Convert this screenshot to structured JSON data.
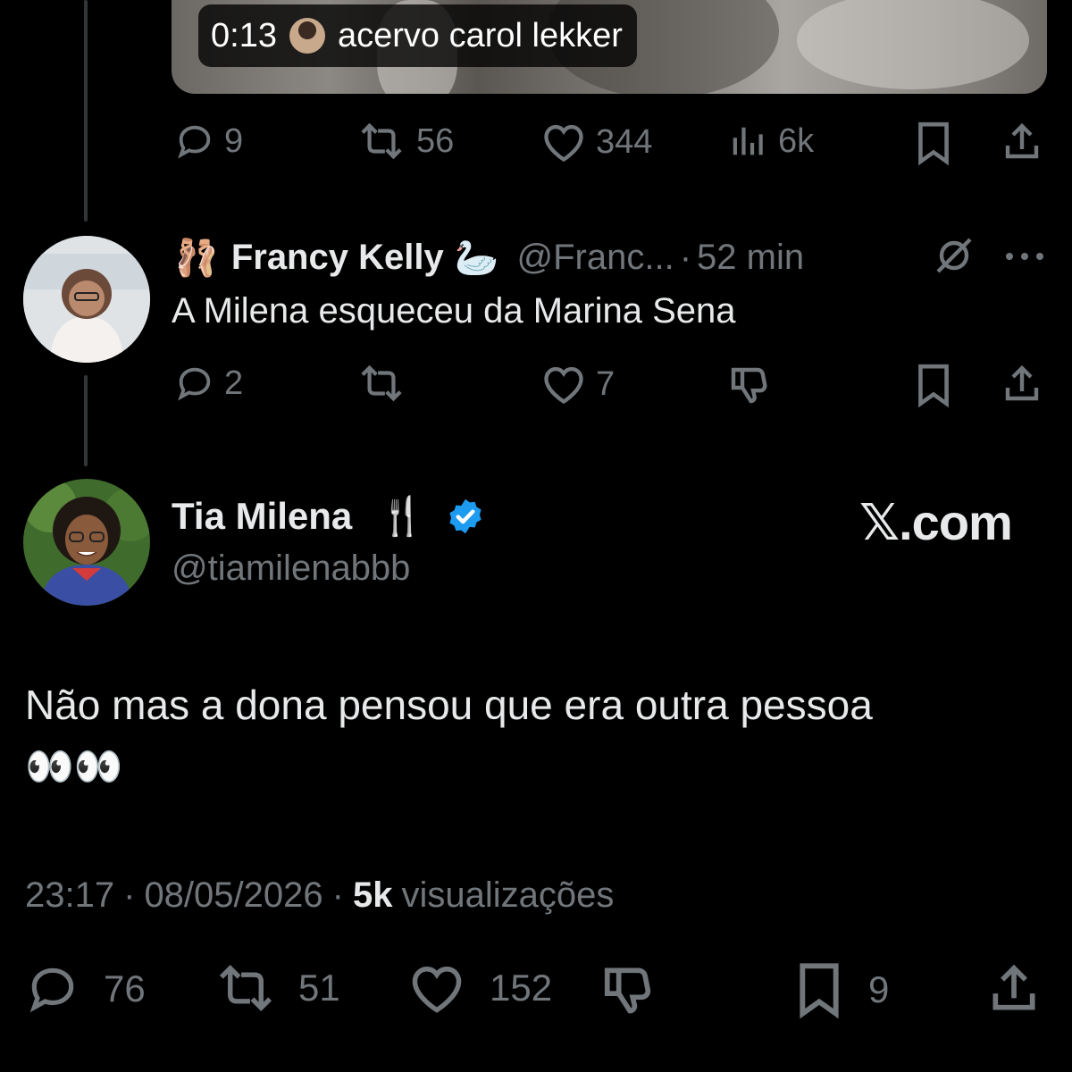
{
  "prev_tweet": {
    "video_time": "0:13",
    "video_source": "acervo carol lekker",
    "replies": "9",
    "retweets": "56",
    "likes": "344",
    "views": "6k"
  },
  "reply": {
    "emoji_prefix": "🩰",
    "name": "Francy Kelly",
    "emoji_suffix": "🦢",
    "handle": "@Franc...",
    "separator": "·",
    "time": "52 min",
    "text": "A Milena esqueceu da Marina Sena",
    "replies": "2",
    "retweets": "",
    "likes": "7"
  },
  "main_tweet": {
    "name": "Tia Milena",
    "name_emoji": "🍴",
    "handle": "@tiamilenabbb",
    "watermark": "𝕏.com",
    "text_line1": "Não mas a dona pensou que era outra pessoa",
    "text_line2": "👀👀",
    "time": "23:17",
    "sep1": "·",
    "date": "08/05/2026",
    "sep2": "·",
    "views_count": "5k",
    "views_label": "visualizações",
    "replies": "76",
    "retweets": "51",
    "likes": "152",
    "bookmarks": "9"
  },
  "colors": {
    "background": "#000000",
    "text": "#e7e9ea",
    "muted": "#71767b",
    "verified": "#1d9bf0",
    "thread_line": "#333639"
  },
  "icons": [
    "reply-icon",
    "retweet-icon",
    "like-icon",
    "views-icon",
    "bookmark-icon",
    "share-icon",
    "grok-icon",
    "more-icon",
    "dislike-icon",
    "verified-badge-icon"
  ]
}
